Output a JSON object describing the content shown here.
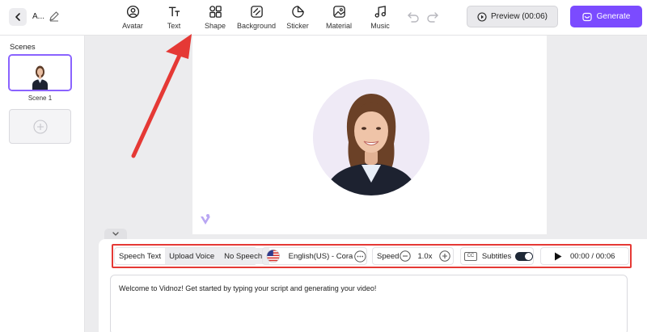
{
  "header": {
    "project_title": "A...",
    "tools": [
      {
        "label": "Avatar",
        "icon": "avatar-icon"
      },
      {
        "label": "Text",
        "icon": "text-icon"
      },
      {
        "label": "Shape",
        "icon": "shape-icon"
      },
      {
        "label": "Background",
        "icon": "background-icon"
      },
      {
        "label": "Sticker",
        "icon": "sticker-icon"
      },
      {
        "label": "Material",
        "icon": "material-icon"
      },
      {
        "label": "Music",
        "icon": "music-icon"
      }
    ],
    "preview_label": "Preview (00:06)",
    "generate_label": "Generate"
  },
  "sidebar": {
    "title": "Scenes",
    "scenes": [
      {
        "label": "Scene 1"
      }
    ]
  },
  "controls": {
    "speech_text": "Speech Text",
    "upload_voice": "Upload Voice",
    "no_speech": "No Speech",
    "voice": "English(US) - Cora",
    "speed_label": "Speed",
    "speed_value": "1.0x",
    "cc_badge": "CC",
    "subtitles_label": "Subtitles",
    "time": "00:00 / 00:06"
  },
  "script": {
    "text": "Welcome to Vidnoz! Get started by typing your script and generating your video!"
  },
  "colors": {
    "accent": "#7b4bff",
    "annotation": "#e53935"
  }
}
